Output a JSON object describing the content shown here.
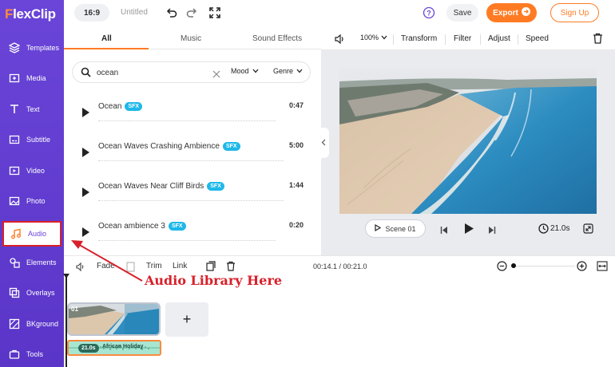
{
  "app": {
    "logo_prefix": "F",
    "logo_rest": "lexClip"
  },
  "sidebar": {
    "items": [
      {
        "label": "Templates",
        "icon": "layers-icon"
      },
      {
        "label": "Media",
        "icon": "media-add-icon"
      },
      {
        "label": "Text",
        "icon": "text-icon"
      },
      {
        "label": "Subtitle",
        "icon": "subtitle-icon"
      },
      {
        "label": "Video",
        "icon": "video-icon"
      },
      {
        "label": "Photo",
        "icon": "photo-icon"
      },
      {
        "label": "Audio",
        "icon": "music-note-icon",
        "active": true
      },
      {
        "label": "Elements",
        "icon": "elements-icon"
      },
      {
        "label": "Overlays",
        "icon": "overlays-icon"
      },
      {
        "label": "BKground",
        "icon": "background-icon"
      },
      {
        "label": "Tools",
        "icon": "toolbox-icon"
      }
    ]
  },
  "topbar": {
    "aspect": "16:9",
    "project_title": "Untitled",
    "save": "Save",
    "export": "Export",
    "signup": "Sign Up"
  },
  "audio_panel": {
    "tabs": [
      "All",
      "Music",
      "Sound Effects"
    ],
    "search": {
      "value": "ocean"
    },
    "filters": {
      "mood": "Mood",
      "genre": "Genre"
    },
    "tracks": [
      {
        "title": "Ocean",
        "badge": "SFX",
        "duration": "0:47"
      },
      {
        "title": "Ocean Waves Crashing Ambience",
        "badge": "SFX",
        "duration": "5:00"
      },
      {
        "title": "Ocean Waves Near Cliff Birds",
        "badge": "SFX",
        "duration": "1:44"
      },
      {
        "title": "Ocean ambience 3",
        "badge": "SFX",
        "duration": "0:20"
      }
    ]
  },
  "preview_toolbar": {
    "zoom": "100%",
    "transform": "Transform",
    "filter": "Filter",
    "adjust": "Adjust",
    "speed": "Speed"
  },
  "player": {
    "scene": "Scene 01",
    "duration": "21.0s"
  },
  "timeline": {
    "fade": "Fade",
    "trim": "Trim",
    "link": "Link",
    "time": "00:14.1 / 00:21.0",
    "zoom_fraction": 0.0,
    "scene_number": "01",
    "add": "+",
    "audio_clip": {
      "duration": "21.0s",
      "name": "African Holiday"
    }
  },
  "annotation": {
    "text": "Audio Library Here",
    "color": "#d8202a"
  },
  "colors": {
    "brand": "#6a45d8",
    "accent": "#ff7b23",
    "sfx_badge": "#1fb8e8"
  }
}
